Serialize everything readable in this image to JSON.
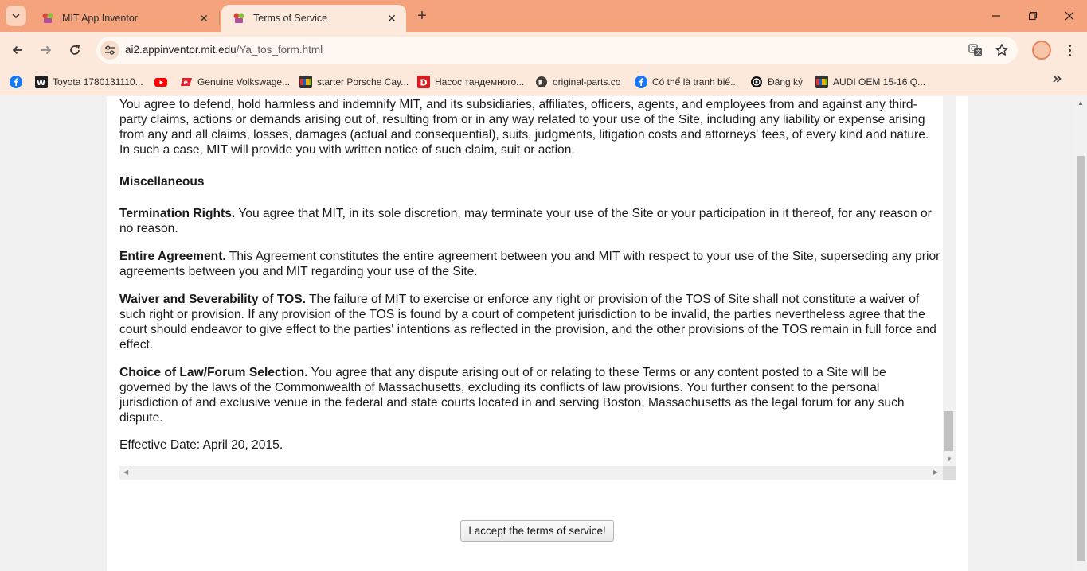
{
  "browser": {
    "tabs": [
      {
        "title": "MIT App Inventor",
        "active": false
      },
      {
        "title": "Terms of Service",
        "active": true
      }
    ],
    "url_host": "ai2.appinventor.mit.edu",
    "url_path": "/Ya_tos_form.html",
    "colors": {
      "tabstrip": "#f4a37c",
      "toolbar": "#fde9db"
    }
  },
  "bookmarks": [
    {
      "label": "",
      "icon": "facebook-icon"
    },
    {
      "label": "Toyota 1780131110...",
      "icon": "vw-icon"
    },
    {
      "label": "",
      "icon": "youtube-icon"
    },
    {
      "label": "Genuine Volkswage...",
      "icon": "store-icon"
    },
    {
      "label": "starter Porsche Cay...",
      "icon": "shop-icon"
    },
    {
      "label": "Насос тандемного...",
      "icon": "d-icon"
    },
    {
      "label": "original-parts.co",
      "icon": "globe-icon"
    },
    {
      "label": "Có thể là tranh biế...",
      "icon": "facebook-icon"
    },
    {
      "label": "Đăng ký",
      "icon": "record-icon"
    },
    {
      "label": "AUDI OEM 15-16 Q...",
      "icon": "shop-icon"
    }
  ],
  "tos": {
    "indemnity": "You agree to defend, hold harmless and indemnify MIT, and its subsidiaries, affiliates, officers, agents, and employees from and against any third-party claims, actions or demands arising out of, resulting from or in any way related to your use of the Site, including any liability or expense arising from any and all claims, losses, damages (actual and consequential), suits, judgments, litigation costs and attorneys' fees, of every kind and nature. In such a case, MIT will provide you with written notice of such claim, suit or action.",
    "misc_heading": "Miscellaneous",
    "termination_title": "Termination Rights.",
    "termination_body": " You agree that MIT, in its sole discretion, may terminate your use of the Site or your participation in it thereof, for any reason or no reason.",
    "entire_title": "Entire Agreement.",
    "entire_body": " This Agreement constitutes the entire agreement between you and MIT with respect to your use of the Site, superseding any prior agreements between you and MIT regarding your use of the Site.",
    "waiver_title": "Waiver and Severability of TOS.",
    "waiver_body": " The failure of MIT to exercise or enforce any right or provision of the TOS of Site shall not constitute a waiver of such right or provision. If any provision of the TOS is found by a court of competent jurisdiction to be invalid, the parties nevertheless agree that the court should endeavor to give effect to the parties' intentions as reflected in the provision, and the other provisions of the TOS remain in full force and effect.",
    "law_title": "Choice of Law/Forum Selection.",
    "law_body": " You agree that any dispute arising out of or relating to these Terms or any content posted to a Site will be governed by the laws of the Commonwealth of Massachusetts, excluding its conflicts of law provisions. You further consent to the personal jurisdiction of and exclusive venue in the federal and state courts located in and serving Boston, Massachusetts as the legal forum for any such dispute.",
    "effective_date": "Effective Date: April 20, 2015."
  },
  "accept_button": "I accept the terms of service!"
}
